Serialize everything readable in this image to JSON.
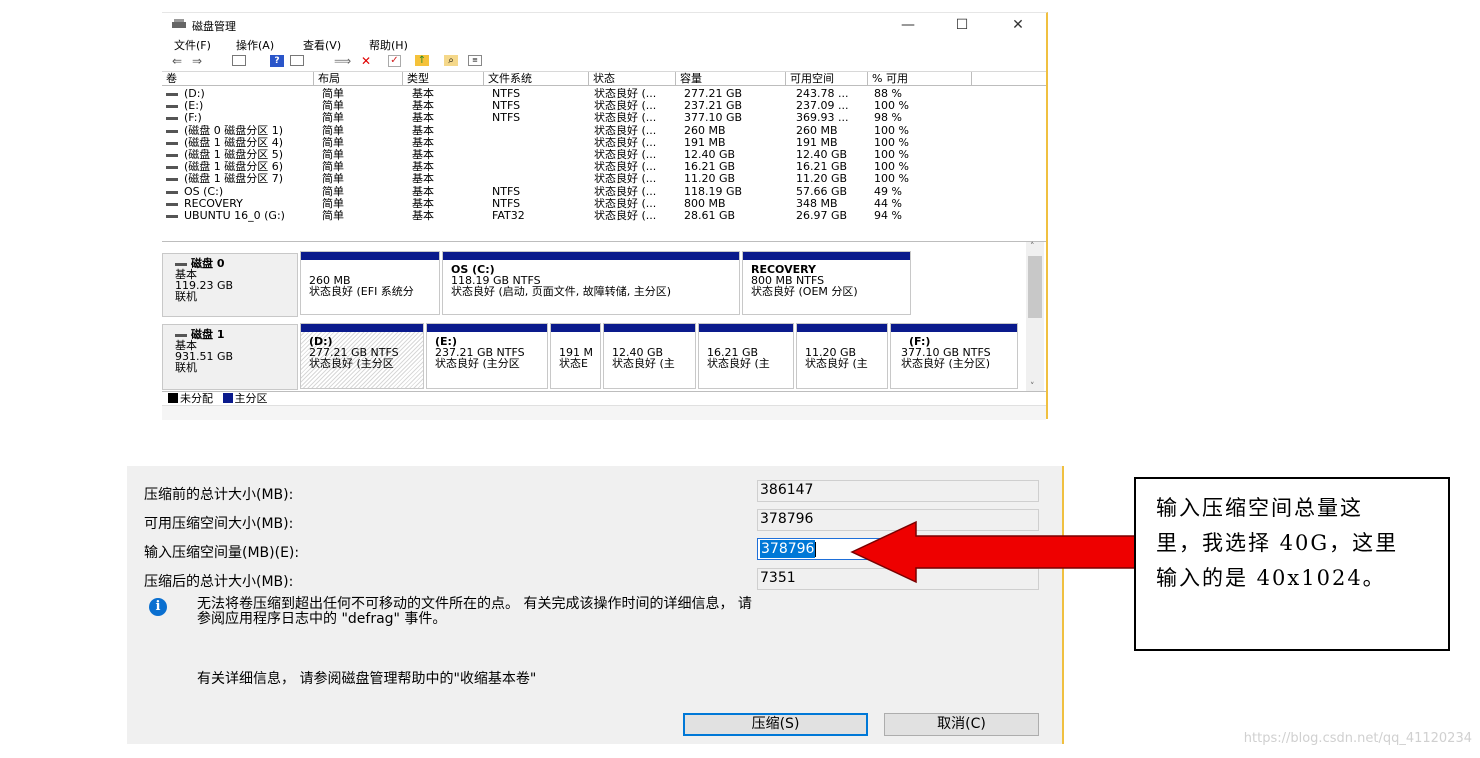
{
  "disk_management": {
    "title": "磁盘管理",
    "window_buttons": {
      "minimize": "—",
      "maximize": "☐",
      "close": "✕"
    },
    "menu": [
      "文件(F)",
      "操作(A)",
      "查看(V)",
      "帮助(H)"
    ],
    "toolbar_icons": [
      "back-arrow-icon",
      "forward-arrow-icon",
      "console-icon",
      "help-icon",
      "properties-icon",
      "connect-icon",
      "delete-icon",
      "check-icon",
      "import-icon",
      "search-icon",
      "list-icon"
    ],
    "columns": [
      "卷",
      "布局",
      "类型",
      "文件系统",
      "状态",
      "容量",
      "可用空间",
      "% 可用"
    ],
    "rows": [
      [
        "(D:)",
        "简单",
        "基本",
        "NTFS",
        "状态良好 (...",
        "277.21 GB",
        "243.78 ...",
        "88 %"
      ],
      [
        "(E:)",
        "简单",
        "基本",
        "NTFS",
        "状态良好 (...",
        "237.21 GB",
        "237.09 ...",
        "100 %"
      ],
      [
        "(F:)",
        "简单",
        "基本",
        "NTFS",
        "状态良好 (...",
        "377.10 GB",
        "369.93 ...",
        "98 %"
      ],
      [
        "(磁盘 0 磁盘分区 1)",
        "简单",
        "基本",
        "",
        "状态良好 (...",
        "260 MB",
        "260 MB",
        "100 %"
      ],
      [
        "(磁盘 1 磁盘分区 4)",
        "简单",
        "基本",
        "",
        "状态良好 (...",
        "191 MB",
        "191 MB",
        "100 %"
      ],
      [
        "(磁盘 1 磁盘分区 5)",
        "简单",
        "基本",
        "",
        "状态良好 (...",
        "12.40 GB",
        "12.40 GB",
        "100 %"
      ],
      [
        "(磁盘 1 磁盘分区 6)",
        "简单",
        "基本",
        "",
        "状态良好 (...",
        "16.21 GB",
        "16.21 GB",
        "100 %"
      ],
      [
        "(磁盘 1 磁盘分区 7)",
        "简单",
        "基本",
        "",
        "状态良好 (...",
        "11.20 GB",
        "11.20 GB",
        "100 %"
      ],
      [
        "OS (C:)",
        "简单",
        "基本",
        "NTFS",
        "状态良好 (...",
        "118.19 GB",
        "57.66 GB",
        "49 %"
      ],
      [
        "RECOVERY",
        "简单",
        "基本",
        "NTFS",
        "状态良好 (...",
        "800 MB",
        "348 MB",
        "44 %"
      ],
      [
        "UBUNTU 16_0 (G:)",
        "简单",
        "基本",
        "FAT32",
        "状态良好 (...",
        "28.61 GB",
        "26.97 GB",
        "94 %"
      ]
    ],
    "disks": [
      {
        "name": "磁盘 0",
        "type": "基本",
        "size": "119.23 GB",
        "state": "联机",
        "partitions": [
          {
            "name": "",
            "size": "260 MB",
            "status": "状态良好 (EFI 系统分"
          },
          {
            "name": "OS (C:)",
            "size": "118.19 GB NTFS",
            "status": "状态良好 (启动, 页面文件, 故障转储, 主分区)"
          },
          {
            "name": "RECOVERY",
            "size": "800 MB NTFS",
            "status": "状态良好 (OEM 分区)"
          }
        ]
      },
      {
        "name": "磁盘 1",
        "type": "基本",
        "size": "931.51 GB",
        "state": "联机",
        "partitions": [
          {
            "name": "(D:)",
            "size": "277.21 GB NTFS",
            "status": "状态良好 (主分区"
          },
          {
            "name": "(E:)",
            "size": "237.21 GB NTFS",
            "status": "状态良好 (主分区"
          },
          {
            "name": "",
            "size": "191 M",
            "status": "状态E"
          },
          {
            "name": "",
            "size": "12.40 GB",
            "status": "状态良好 (主"
          },
          {
            "name": "",
            "size": "16.21 GB",
            "status": "状态良好 (主"
          },
          {
            "name": "",
            "size": "11.20 GB",
            "status": "状态良好 (主"
          },
          {
            "name": "(F:)",
            "size": "377.10 GB NTFS",
            "status": "状态良好 (主分区)"
          }
        ]
      }
    ],
    "legend": [
      {
        "label": "未分配",
        "color": "#000000"
      },
      {
        "label": "主分区",
        "color": "#0a1a8c"
      }
    ]
  },
  "shrink_dialog": {
    "total_before_label": "压缩前的总计大小(MB):",
    "total_before_value": "386147",
    "available_label": "可用压缩空间大小(MB):",
    "available_value": "378796",
    "input_label": "输入压缩空间量(MB)(E):",
    "input_value": "378796",
    "total_after_label": "压缩后的总计大小(MB):",
    "total_after_value": "7351",
    "info_icon": "i",
    "message_line1": "无法将卷压缩到超出任何不可移动的文件所在的点。 有关完成该操作时间的详细信息， 请",
    "message_line2": "参阅应用程序日志中的 \"defrag\" 事件。",
    "detail": "有关详细信息， 请参阅磁盘管理帮助中的\"收缩基本卷\"",
    "shrink_button": "压缩(S)",
    "cancel_button": "取消(C)"
  },
  "annotation": {
    "line1": "输入压缩空间总量这",
    "line2": "里，我选择 40G，这里",
    "line3": "输入的是 40x1024。",
    "arrow_color": "#ee0000"
  },
  "watermark": "https://blog.csdn.net/qq_41120234"
}
